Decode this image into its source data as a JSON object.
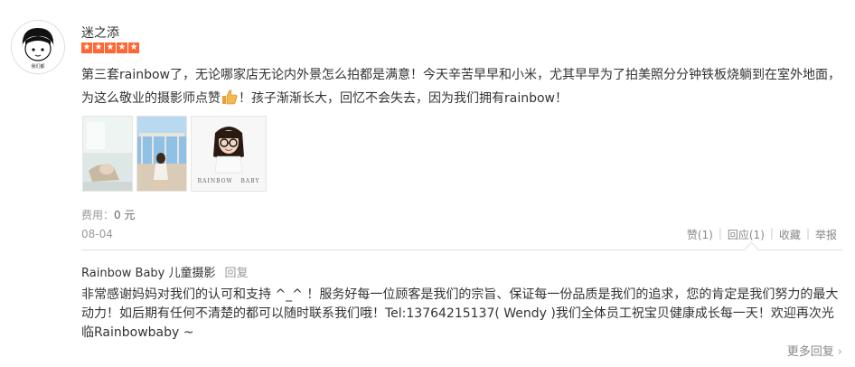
{
  "reviewer": {
    "name": "迷之添",
    "rating": 5,
    "avatar_icon": "cartoon-avatar-icon"
  },
  "review": {
    "text_before_icon": "第三套rainbow了，无论哪家店无论内外景怎么拍都是满意！今天辛苦早早和小米，尤其早早为了拍美照分分钟铁板烧躺到在室外地面，为这么敬业的摄影师点赞",
    "text_after_icon": "！孩子渐渐长大，回忆不会失去，因为我们拥有rainbow！",
    "emoji_icon": "thumbs-up-icon"
  },
  "photos": [
    {
      "name": "photo-1"
    },
    {
      "name": "photo-2"
    },
    {
      "name": "photo-3",
      "watermark": "RAINBOW   BABY"
    }
  ],
  "fee": {
    "label": "费用：",
    "value": "0 元"
  },
  "date": "08-04",
  "actions": [
    {
      "label": "赞(1)"
    },
    {
      "label": "回应(1)"
    },
    {
      "label": "收藏"
    },
    {
      "label": "举报"
    }
  ],
  "reply": {
    "author": "Rainbow Baby 儿童摄影",
    "tag": "回复",
    "text": "非常感谢妈妈对我们的认可和支持 ^_^ ！服务好每一位顾客是我们的宗旨、保证每一份品质是我们的追求，您的肯定是我们努力的最大动力！如后期有任何不清楚的都可以随时联系我们哦！Tel:13764215137( Wendy )我们全体员工祝宝贝健康成长每一天！欢迎再次光临Rainbowbaby ~"
  },
  "more_replies": "更多回复",
  "colors": {
    "star": "#ff6633",
    "muted": "#999999",
    "divider": "#e0e0e0"
  }
}
